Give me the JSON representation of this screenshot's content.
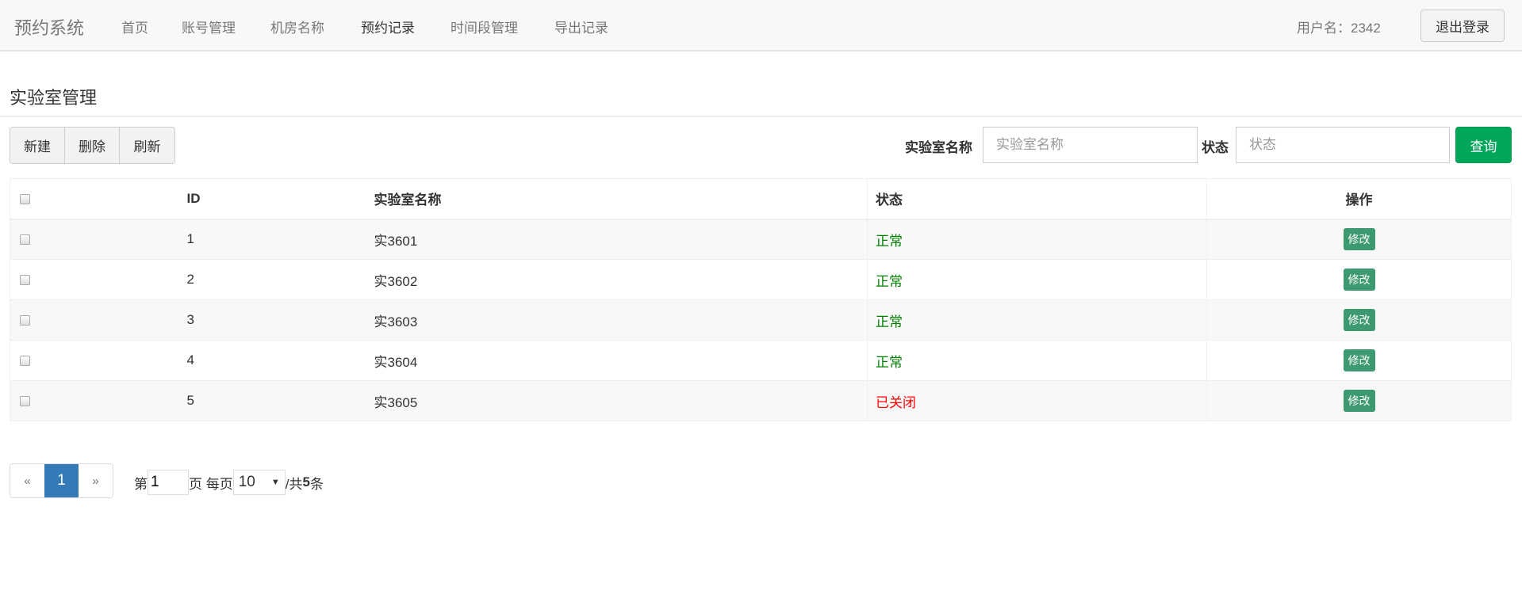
{
  "navbar": {
    "brand": "预约系统",
    "items": [
      "首页",
      "账号管理",
      "机房名称",
      "预约记录",
      "时间段管理",
      "导出记录"
    ],
    "active_index": 3,
    "user": "用户名：2342",
    "logout": "退出登录"
  },
  "page": {
    "title": "实验室管理"
  },
  "toolbar": {
    "new": "新建",
    "delete": "删除",
    "refresh": "刷新",
    "name_label": "实验室名称",
    "name_placeholder": "实验室名称",
    "status_label": "状态",
    "status_placeholder": "状态",
    "query": "查询"
  },
  "table": {
    "headers": [
      "ID",
      "实验室名称",
      "状态",
      "操作"
    ],
    "rows": [
      {
        "id": "1",
        "name": "实3601",
        "status": "正常",
        "status_color": "#008000",
        "action": "修改"
      },
      {
        "id": "2",
        "name": "实3602",
        "status": "正常",
        "status_color": "#008000",
        "action": "修改"
      },
      {
        "id": "3",
        "name": "实3603",
        "status": "正常",
        "status_color": "#008000",
        "action": "修改"
      },
      {
        "id": "4",
        "name": "实3604",
        "status": "正常",
        "status_color": "#008000",
        "action": "修改"
      },
      {
        "id": "5",
        "name": "实3605",
        "status": "已关闭",
        "status_color": "#ff0000",
        "action": "修改"
      }
    ]
  },
  "pagination": {
    "prev": "«",
    "current": "1",
    "next": "»",
    "page_prefix": "第",
    "page_value": "1",
    "page_suffix": "页 每页",
    "per_page": "10",
    "total_prefix": "/共",
    "total": "5",
    "total_suffix": "条"
  }
}
